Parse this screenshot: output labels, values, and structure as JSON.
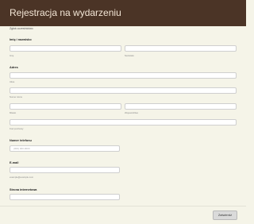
{
  "header": {
    "title": "Rejestracja na wydarzeniu"
  },
  "form": {
    "description": "Zgłoś uczestnictwo",
    "name": {
      "label": "Imię i nazwisko",
      "first_sub": "Imię",
      "last_sub": "Nazwisko",
      "first_value": "",
      "last_value": ""
    },
    "address": {
      "label": "Adres",
      "street_sub": "Ulica",
      "street2_sub": "Numer domu",
      "city_sub": "Miasto",
      "region_sub": "Województwo",
      "postal_sub": "Kod pocztowy"
    },
    "phone": {
      "label": "Numer telefonu",
      "placeholder": "(000) 000-0000"
    },
    "email": {
      "label": "E-mail",
      "sub": "example@example.com"
    },
    "website": {
      "label": "Strona internetowa"
    },
    "submit_label": "Zatwierdź"
  }
}
